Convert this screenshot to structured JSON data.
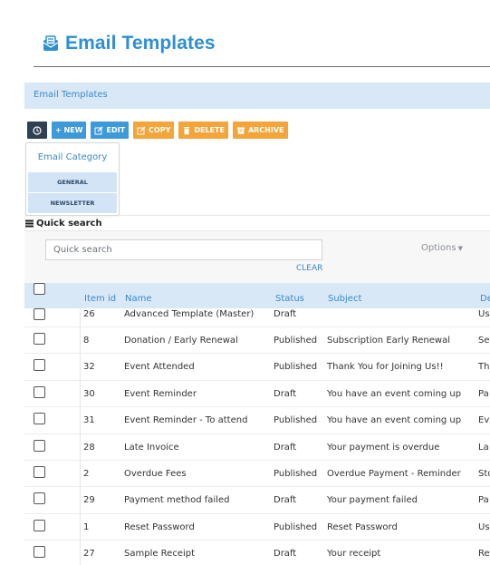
{
  "page": {
    "title": "Email Templates"
  },
  "breadcrumb": {
    "label": "Email Templates"
  },
  "toolbar": {
    "new": "+ NEW",
    "edit": "EDIT",
    "copy": "COPY",
    "delete": "DELETE",
    "archive": "ARCHIVE"
  },
  "category": {
    "heading": "Email Category",
    "items": [
      "GENERAL",
      "NEWSLETTER"
    ]
  },
  "quick_search": {
    "label": "Quick search",
    "placeholder": "Quick search",
    "options": "Options",
    "clear": "CLEAR"
  },
  "table": {
    "columns": [
      "Item id",
      "Name",
      "Status",
      "Subject",
      "De"
    ],
    "rows": [
      {
        "id": "26",
        "name": "Advanced Template (Master)",
        "status": "Draft",
        "subject": "",
        "desc": "Us"
      },
      {
        "id": "8",
        "name": "Donation / Early Renewal",
        "status": "Published",
        "subject": "Subscription Early Renewal",
        "desc": "Se"
      },
      {
        "id": "32",
        "name": "Event Attended",
        "status": "Published",
        "subject": "Thank You for Joining Us!!",
        "desc": "Th"
      },
      {
        "id": "30",
        "name": "Event Reminder",
        "status": "Draft",
        "subject": "You have an event coming up",
        "desc": "Pa"
      },
      {
        "id": "31",
        "name": "Event Reminder - To attend",
        "status": "Published",
        "subject": "You have an event coming up",
        "desc": "Ev"
      },
      {
        "id": "28",
        "name": "Late Invoice",
        "status": "Draft",
        "subject": "Your payment is overdue",
        "desc": "La"
      },
      {
        "id": "2",
        "name": "Overdue Fees",
        "status": "Published",
        "subject": "Overdue Payment - Reminder",
        "desc": "Sto"
      },
      {
        "id": "29",
        "name": "Payment method failed",
        "status": "Draft",
        "subject": "Your payment failed",
        "desc": "Pa"
      },
      {
        "id": "1",
        "name": "Reset Password",
        "status": "Published",
        "subject": "Reset Password",
        "desc": "Us"
      },
      {
        "id": "27",
        "name": "Sample Receipt",
        "status": "Draft",
        "subject": "Your receipt",
        "desc": "Re"
      }
    ]
  },
  "colors": {
    "accent": "#2e8fd3",
    "header_bg": "#d8e8f7",
    "orange": "#f4a53a",
    "dark": "#2f4054"
  }
}
